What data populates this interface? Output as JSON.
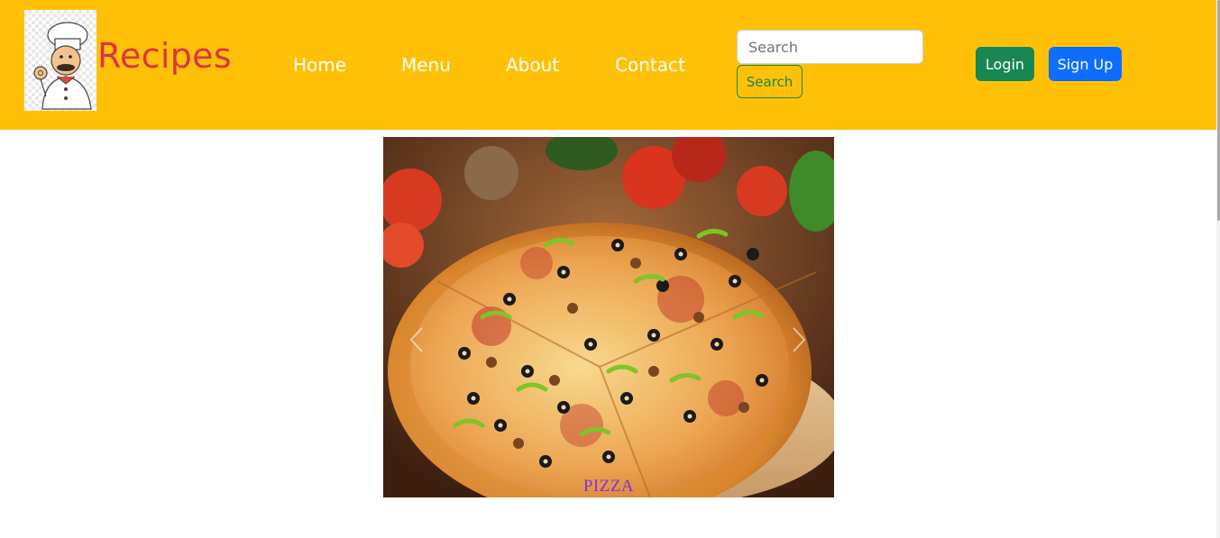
{
  "brand": {
    "name": "Recipes",
    "logo_icon": "chef-icon"
  },
  "nav": [
    {
      "label": "Home"
    },
    {
      "label": "Menu"
    },
    {
      "label": "About"
    },
    {
      "label": "Contact"
    }
  ],
  "search": {
    "placeholder": "Search",
    "button_label": "Search"
  },
  "auth": {
    "login_label": "Login",
    "signup_label": "Sign Up"
  },
  "carousel": {
    "slide_caption": "PIZZA",
    "prev_icon": "chevron-left-icon",
    "next_icon": "chevron-right-icon"
  },
  "colors": {
    "navbar": "#ffc107",
    "brand": "#dc3545",
    "login": "#198754",
    "signup": "#0d6efd",
    "caption": "#8a2be2"
  }
}
